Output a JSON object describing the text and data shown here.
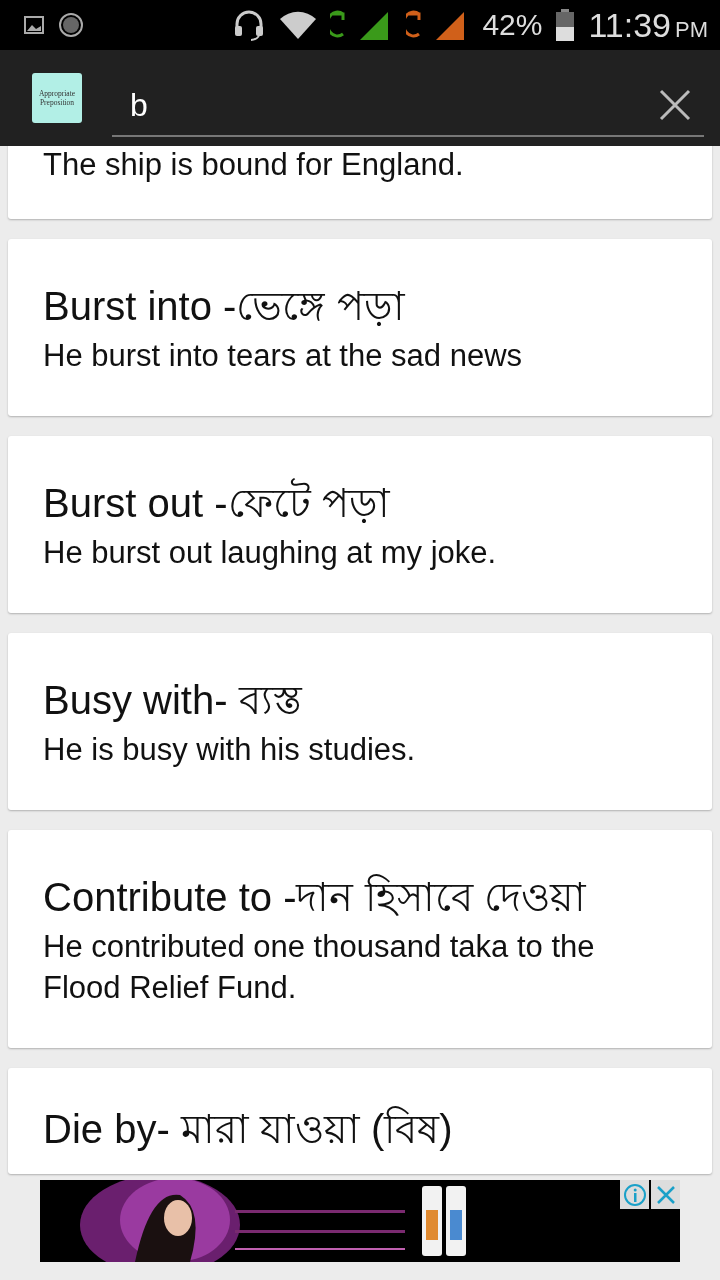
{
  "status_bar": {
    "battery": "42%",
    "time": "11:39",
    "ampm": "PM"
  },
  "header": {
    "logo_lines": [
      "Appropriate",
      "Preposition"
    ],
    "search": {
      "value": "b"
    }
  },
  "entries": [
    {
      "example": "The ship is bound for England."
    },
    {
      "title": "Burst into -ভেঙ্গে পড়া",
      "example": "He burst into tears at the sad news"
    },
    {
      "title": "Burst out -ফেটে পড়া",
      "example": "He burst out laughing at my joke."
    },
    {
      "title": "Busy with- ব্যস্ত",
      "example": "He is busy with his studies."
    },
    {
      "title": "Contribute to -দান হিসাবে দেওয়া",
      "example": "He contributed one thousand taka to the Flood Relief Fund."
    },
    {
      "title": "Die by- মারা যাওয়া (বিষ)"
    }
  ]
}
